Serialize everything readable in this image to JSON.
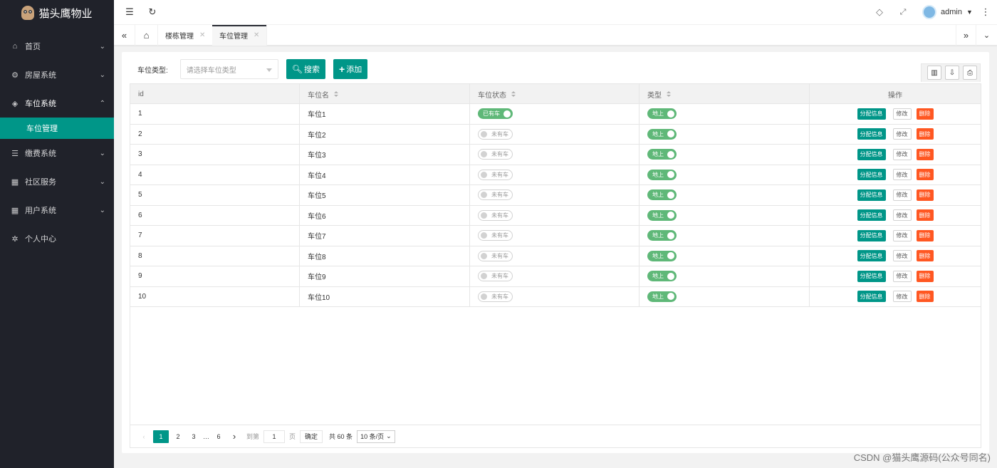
{
  "app": {
    "name": "猫头鹰物业"
  },
  "sidebar": {
    "items": [
      {
        "label": "首页",
        "icon": "home-icon"
      },
      {
        "label": "房屋系统",
        "icon": "gear-icon"
      },
      {
        "label": "车位系统",
        "icon": "cube-icon",
        "expanded": true
      },
      {
        "label": "缴费系统",
        "icon": "list-icon"
      },
      {
        "label": "社区服务",
        "icon": "apps-icon"
      },
      {
        "label": "用户系统",
        "icon": "apps-icon"
      },
      {
        "label": "个人中心",
        "icon": "settings-icon"
      }
    ],
    "active_sub": "车位管理"
  },
  "header": {
    "user": "admin"
  },
  "tabs": [
    {
      "label": "楼栋管理",
      "active": false
    },
    {
      "label": "车位管理",
      "active": true
    }
  ],
  "filter": {
    "label": "车位类型:",
    "placeholder": "请选择车位类型",
    "search_label": "搜索",
    "add_label": "添加"
  },
  "table": {
    "columns": [
      "id",
      "车位名",
      "车位状态",
      "类型",
      "操作"
    ],
    "rows": [
      {
        "id": "1",
        "name": "车位1",
        "status": "已有车",
        "type": "地上"
      },
      {
        "id": "2",
        "name": "车位2",
        "status": "未有车",
        "type": "地上"
      },
      {
        "id": "3",
        "name": "车位3",
        "status": "未有车",
        "type": "地上"
      },
      {
        "id": "4",
        "name": "车位4",
        "status": "未有车",
        "type": "地上"
      },
      {
        "id": "5",
        "name": "车位5",
        "status": "未有车",
        "type": "地上"
      },
      {
        "id": "6",
        "name": "车位6",
        "status": "未有车",
        "type": "地上"
      },
      {
        "id": "7",
        "name": "车位7",
        "status": "未有车",
        "type": "地上"
      },
      {
        "id": "8",
        "name": "车位8",
        "status": "未有车",
        "type": "地上"
      },
      {
        "id": "9",
        "name": "车位9",
        "status": "未有车",
        "type": "地上"
      },
      {
        "id": "10",
        "name": "车位10",
        "status": "未有车",
        "type": "地上"
      }
    ],
    "actions": {
      "assign": "分配信息",
      "edit": "修改",
      "delete": "删除"
    }
  },
  "pager": {
    "pages": [
      "1",
      "2",
      "3",
      "…",
      "6"
    ],
    "current": "1",
    "goto_label": "到第",
    "goto_value": "1",
    "page_unit": "页",
    "confirm": "确定",
    "total": "共 60 条",
    "page_size": "10 条/页"
  },
  "watermark": "CSDN @猫头鹰源码(公众号同名)",
  "colors": {
    "primary": "#009688",
    "sidebar": "#20222a",
    "switch_on": "#5fb878",
    "danger": "#ff5722"
  }
}
